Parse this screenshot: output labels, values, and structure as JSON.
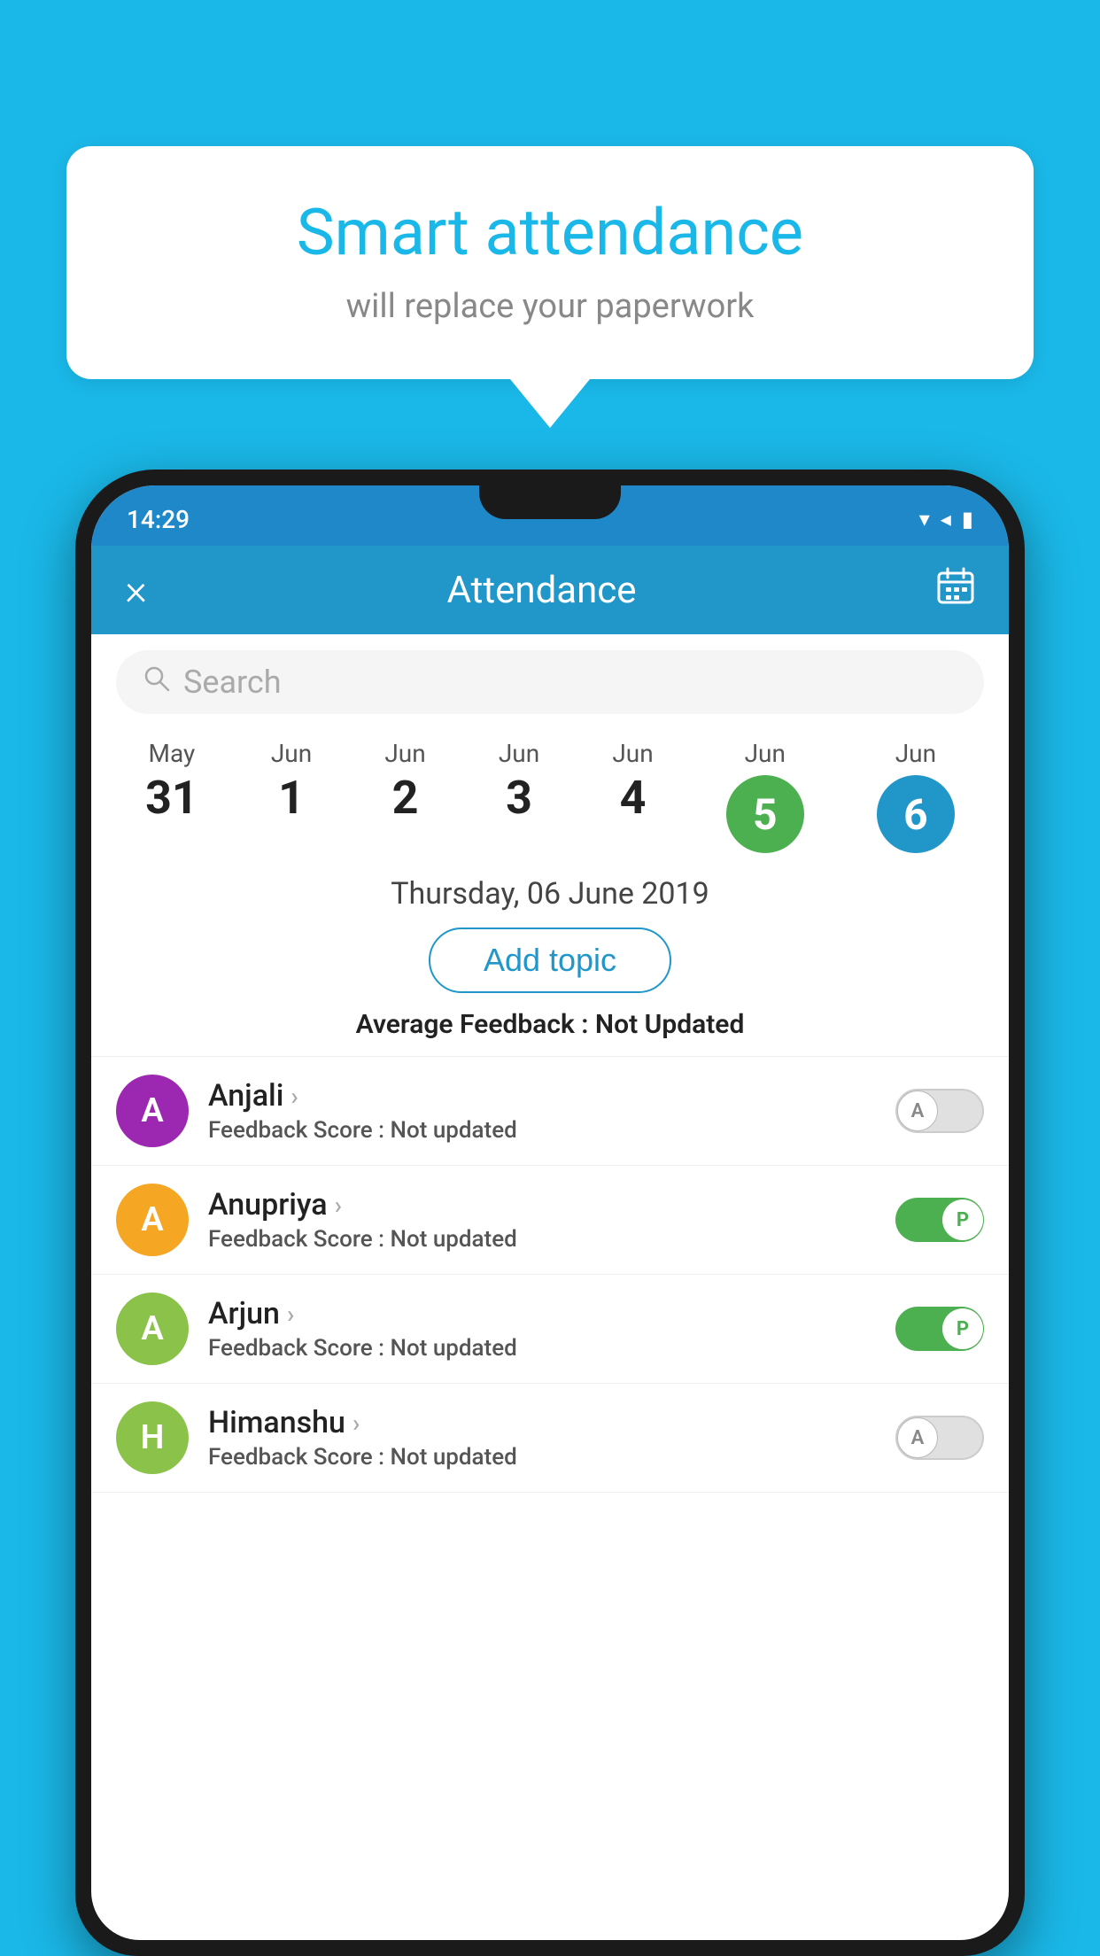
{
  "app": {
    "background_color": "#1ab8e8"
  },
  "speech_bubble": {
    "title": "Smart attendance",
    "subtitle": "will replace your paperwork"
  },
  "status_bar": {
    "time": "14:29"
  },
  "header": {
    "title": "Attendance",
    "close_label": "×",
    "calendar_icon": "📅"
  },
  "search": {
    "placeholder": "Search"
  },
  "dates": [
    {
      "month": "May",
      "day": "31",
      "highlighted": false,
      "today": false
    },
    {
      "month": "Jun",
      "day": "1",
      "highlighted": false,
      "today": false
    },
    {
      "month": "Jun",
      "day": "2",
      "highlighted": false,
      "today": false
    },
    {
      "month": "Jun",
      "day": "3",
      "highlighted": false,
      "today": false
    },
    {
      "month": "Jun",
      "day": "4",
      "highlighted": false,
      "today": false
    },
    {
      "month": "Jun",
      "day": "5",
      "highlighted": true,
      "color": "green",
      "today": false
    },
    {
      "month": "Jun",
      "day": "6",
      "highlighted": true,
      "color": "blue",
      "today": true
    }
  ],
  "selected_date": "Thursday, 06 June 2019",
  "add_topic_label": "Add topic",
  "avg_feedback_label": "Average Feedback :",
  "avg_feedback_value": "Not Updated",
  "students": [
    {
      "name": "Anjali",
      "avatar_letter": "A",
      "avatar_color": "#9c27b0",
      "feedback_label": "Feedback Score :",
      "feedback_value": "Not updated",
      "attendance": "A",
      "present": false
    },
    {
      "name": "Anupriya",
      "avatar_letter": "A",
      "avatar_color": "#f5a623",
      "feedback_label": "Feedback Score :",
      "feedback_value": "Not updated",
      "attendance": "P",
      "present": true
    },
    {
      "name": "Arjun",
      "avatar_letter": "A",
      "avatar_color": "#8bc34a",
      "feedback_label": "Feedback Score :",
      "feedback_value": "Not updated",
      "attendance": "P",
      "present": true
    },
    {
      "name": "Himanshu",
      "avatar_letter": "H",
      "avatar_color": "#8bc34a",
      "feedback_label": "Feedback Score :",
      "feedback_value": "Not updated",
      "attendance": "A",
      "present": false
    }
  ],
  "icons": {
    "search": "🔍",
    "chevron": "›"
  }
}
